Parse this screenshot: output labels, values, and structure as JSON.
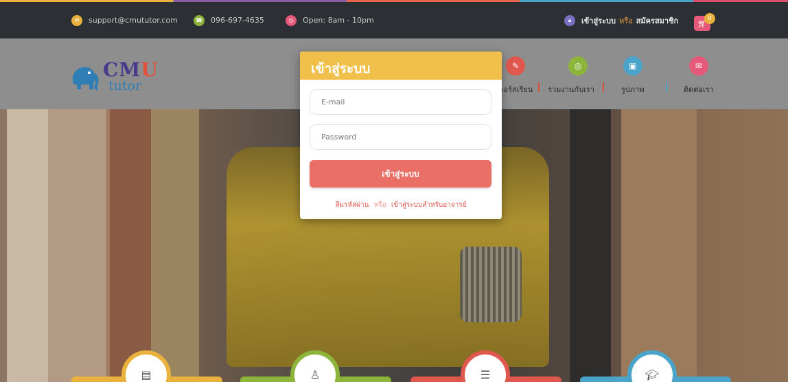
{
  "topbar": {
    "email": "support@cmututor.com",
    "phone": "096-697-4635",
    "hours": "Open: 8am - 10pm",
    "login": "เข้าสู่ระบบ",
    "or": "หรือ",
    "register": "สมัครสมาชิก",
    "cart_count": "0"
  },
  "logo": {
    "cmu": "CM",
    "u": "U",
    "tutor": "tutor"
  },
  "nav": {
    "courses": "คอร์สเรียน",
    "partner": "ร่วมงานกับเรา",
    "gallery": "รูปภาพ",
    "contact": "ติดต่อเรา"
  },
  "modal": {
    "title": "เข้าสู่ระบบ",
    "email_placeholder": "E-mail",
    "password_placeholder": "Password",
    "submit": "เข้าสู่ระบบ",
    "forgot": "ลืมรหัสผ่าน",
    "or": "หรือ",
    "teacher_login": "เข้าสู่ระบบสำหรับอาจารย์"
  },
  "colors": {
    "modal_header": "#f1c04a",
    "submit": "#ea6f66",
    "topbar": "#2c2f33"
  }
}
